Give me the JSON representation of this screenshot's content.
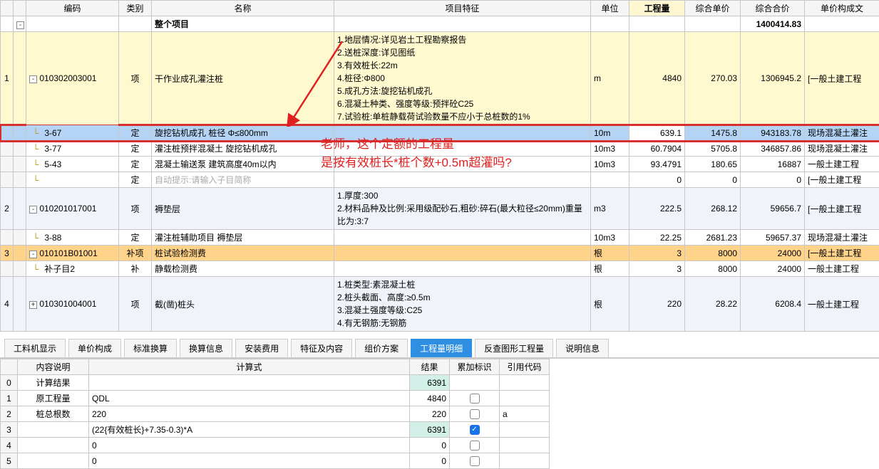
{
  "headers": {
    "code": "编码",
    "category": "类别",
    "name": "名称",
    "feature": "项目特征",
    "unit": "单位",
    "quantity": "工程量",
    "unit_price": "综合单价",
    "total_price": "综合合价",
    "cost_file": "单价构成文"
  },
  "project": {
    "title": "整个项目",
    "grand_total": "1400414.83"
  },
  "rows": [
    {
      "idx": "1",
      "code": "010302003001",
      "cat": "项",
      "name": "干作业成孔灌注桩",
      "feature": "1.地层情况:详见岩土工程勘察报告\n2.送桩深度:详见图纸\n3.有效桩长:22m\n4.桩径:Φ800\n5.成孔方法:旋挖钻机成孔\n6.混凝土种类、强度等级:预拌砼C25\n7.试验桩:单桩静载荷试验数量不应小于总桩数的1%",
      "unit": "m",
      "qty": "4840",
      "uprice": "270.03",
      "total": "1306945.2",
      "cost": "[一般土建工程",
      "cls": "yellow-row",
      "toggle": "-"
    },
    {
      "idx": "",
      "code": "3-67",
      "cat": "定",
      "name": "旋挖钻机成孔 桩径 Φ≤800mm",
      "feature": "",
      "unit": "10m",
      "qty": "639.1",
      "uprice": "1475.8",
      "total": "943183.78",
      "cost": "现场混凝土灌注",
      "cls": "selected-row",
      "qty_input": true
    },
    {
      "idx": "",
      "code": "3-77",
      "cat": "定",
      "name": "灌注桩预拌混凝土 旋挖钻机成孔",
      "feature": "",
      "unit": "10m3",
      "qty": "60.7904",
      "uprice": "5705.8",
      "total": "346857.86",
      "cost": "现场混凝土灌注",
      "cls": ""
    },
    {
      "idx": "",
      "code": "5-43",
      "cat": "定",
      "name": "混凝土输送泵 建筑高度40m以内",
      "feature": "",
      "unit": "10m3",
      "qty": "93.4791",
      "uprice": "180.65",
      "total": "16887",
      "cost": "一般土建工程",
      "cls": ""
    },
    {
      "idx": "",
      "code": "",
      "cat": "定",
      "name_ph": "自动提示:请输入子目简称",
      "feature": "",
      "unit": "",
      "qty": "0",
      "uprice": "0",
      "total": "0",
      "cost": "[一般土建工程",
      "cls": ""
    },
    {
      "idx": "2",
      "code": "010201017001",
      "cat": "项",
      "name": "褥垫层",
      "feature": "1.厚度:300\n2.材料品种及比例:采用级配砂石,粗砂:碎石(最大粒径≤20mm)重量比为:3:7",
      "unit": "m3",
      "qty": "222.5",
      "uprice": "268.12",
      "total": "59656.7",
      "cost": "[一般土建工程",
      "cls": "blue-row",
      "toggle": "-"
    },
    {
      "idx": "",
      "code": "3-88",
      "cat": "定",
      "name": "灌注桩辅助项目 褥垫层",
      "feature": "",
      "unit": "10m3",
      "qty": "22.25",
      "uprice": "2681.23",
      "total": "59657.37",
      "cost": "现场混凝土灌注",
      "cls": ""
    },
    {
      "idx": "3",
      "code": "010101B01001",
      "cat": "补项",
      "name": "桩试验检测费",
      "feature": "",
      "unit": "根",
      "qty": "3",
      "uprice": "8000",
      "total": "24000",
      "cost": "[一般土建工程",
      "cls": "orange-row",
      "toggle": "-"
    },
    {
      "idx": "",
      "code": "补子目2",
      "cat": "补",
      "name": "静载检测费",
      "feature": "",
      "unit": "根",
      "qty": "3",
      "uprice": "8000",
      "total": "24000",
      "cost": "一般土建工程",
      "cls": ""
    },
    {
      "idx": "4",
      "code": "010301004001",
      "cat": "项",
      "name": "截(凿)桩头",
      "feature": "1.桩类型:素混凝土桩\n2.桩头截面、高度:≥0.5m\n3.混凝土强度等级:C25\n4.有无钢筋:无钢筋",
      "unit": "根",
      "qty": "220",
      "uprice": "28.22",
      "total": "6208.4",
      "cost": "一般土建工程",
      "cls": "blue-row",
      "toggle": "+"
    }
  ],
  "tabs": [
    "工料机显示",
    "单价构成",
    "标准换算",
    "换算信息",
    "安装费用",
    "特征及内容",
    "组价方案",
    "工程量明细",
    "反查图形工程量",
    "说明信息"
  ],
  "active_tab": 7,
  "sub_headers": {
    "desc": "内容说明",
    "formula": "计算式",
    "result": "结果",
    "accum": "累加标识",
    "refcode": "引用代码"
  },
  "sub_rows": [
    {
      "idx": "0",
      "desc": "计算结果",
      "formula": "",
      "result": "6391",
      "chk": null,
      "ref": "",
      "res_cls": "cyan-cell"
    },
    {
      "idx": "1",
      "desc": "原工程量",
      "formula": "QDL",
      "result": "4840",
      "chk": false,
      "ref": ""
    },
    {
      "idx": "2",
      "desc": "桩总根数",
      "formula": "220",
      "result": "220",
      "chk": false,
      "ref": "a"
    },
    {
      "idx": "3",
      "desc": "",
      "formula": "(22{有效桩长}+7.35-0.3)*A",
      "result": "6391",
      "chk": true,
      "ref": "",
      "res_cls": "cyan-cell"
    },
    {
      "idx": "4",
      "desc": "",
      "formula": "0",
      "result": "0",
      "chk": false,
      "ref": ""
    },
    {
      "idx": "5",
      "desc": "",
      "formula": "0",
      "result": "0",
      "chk": false,
      "ref": ""
    }
  ],
  "annotation": {
    "line1": "老师，这个定额的工程量",
    "line2": "是按有效桩长*桩个数+0.5m超灌吗?"
  }
}
